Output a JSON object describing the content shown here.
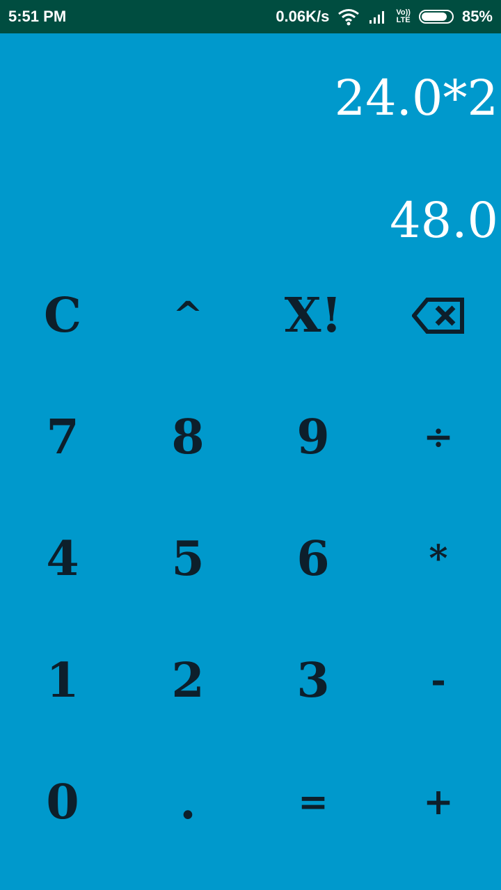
{
  "status_bar": {
    "time": "5:51 PM",
    "network_speed": "0.06K/s",
    "lte_label_top": "Vo))",
    "lte_label_bottom": "LTE",
    "battery_percent": "85%",
    "battery_level": 0.85,
    "icons": [
      "wifi-icon",
      "signal-icon",
      "volte-icon",
      "battery-icon"
    ]
  },
  "display": {
    "expression": "24.0*2",
    "result": "48.0"
  },
  "keypad": {
    "rows": [
      [
        {
          "label": "C",
          "name": "clear-button"
        },
        {
          "label": "^",
          "name": "power-button"
        },
        {
          "label": "X!",
          "name": "factorial-button"
        },
        {
          "label": "",
          "name": "backspace-button",
          "icon": "backspace-icon"
        }
      ],
      [
        {
          "label": "7",
          "name": "digit-7-button"
        },
        {
          "label": "8",
          "name": "digit-8-button"
        },
        {
          "label": "9",
          "name": "digit-9-button"
        },
        {
          "label": "÷",
          "name": "divide-button"
        }
      ],
      [
        {
          "label": "4",
          "name": "digit-4-button"
        },
        {
          "label": "5",
          "name": "digit-5-button"
        },
        {
          "label": "6",
          "name": "digit-6-button"
        },
        {
          "label": "*",
          "name": "multiply-button"
        }
      ],
      [
        {
          "label": "1",
          "name": "digit-1-button"
        },
        {
          "label": "2",
          "name": "digit-2-button"
        },
        {
          "label": "3",
          "name": "digit-3-button"
        },
        {
          "label": "-",
          "name": "subtract-button"
        }
      ],
      [
        {
          "label": "0",
          "name": "digit-0-button"
        },
        {
          "label": ".",
          "name": "decimal-button"
        },
        {
          "label": "=",
          "name": "equals-button"
        },
        {
          "label": "+",
          "name": "add-button"
        }
      ]
    ]
  },
  "colors": {
    "background": "#0099CC",
    "status_bar": "#004D40",
    "display_text": "#FFFFFF",
    "key_text": "#0D1F2B"
  }
}
